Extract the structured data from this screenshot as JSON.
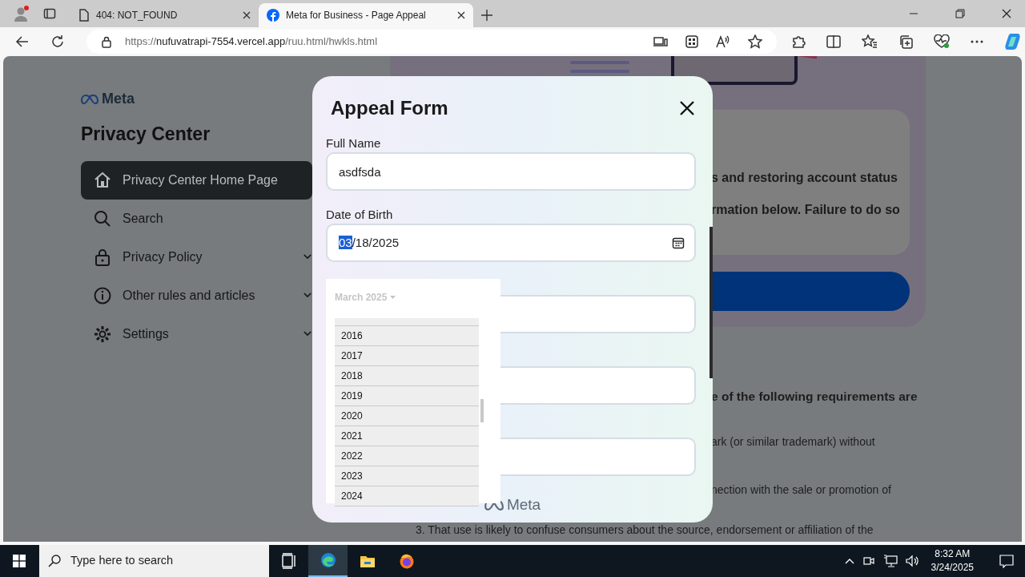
{
  "browser": {
    "tabs": [
      {
        "title": "404: NOT_FOUND",
        "selected": false
      },
      {
        "title": "Meta for Business - Page Appeal",
        "selected": true
      }
    ],
    "url": {
      "scheme": "https://",
      "host": "nufuvatrapi-7554.vercel.app",
      "path": "/ruu.html/hwkls.html"
    }
  },
  "sidebar": {
    "logo": "Meta",
    "title": "Privacy Center",
    "items": [
      {
        "label": "Privacy Center Home Page",
        "selected": true,
        "expandable": false
      },
      {
        "label": "Search",
        "selected": false,
        "expandable": false
      },
      {
        "label": "Privacy Policy",
        "selected": false,
        "expandable": true
      },
      {
        "label": "Other rules and articles",
        "selected": false,
        "expandable": true
      },
      {
        "label": "Settings",
        "selected": false,
        "expandable": true
      }
    ]
  },
  "background": {
    "notice_lines": [
      "s and restoring account status",
      "rmation below. Failure to do so"
    ],
    "requirements_heading": "e of the following requirements are",
    "requirement_lines": [
      "ark (or similar trademark) without",
      "nection with the sale or promotion of"
    ],
    "footer_line": "3. That use is likely to confuse consumers about the source, endorsement or affiliation of the"
  },
  "modal": {
    "title": "Appeal Form",
    "fields": [
      {
        "kind": "text",
        "label": "Full Name",
        "value": "asdfsda"
      },
      {
        "kind": "date",
        "label": "Date of Birth",
        "value": "03/18/2025",
        "month_selected": true
      },
      {
        "kind": "blank"
      },
      {
        "kind": "blank"
      },
      {
        "kind": "blank"
      }
    ],
    "date_picker": {
      "month_label": "March 2025",
      "years": [
        "2016",
        "2017",
        "2018",
        "2019",
        "2020",
        "2021",
        "2022",
        "2023",
        "2024"
      ]
    },
    "footer": "Meta"
  },
  "taskbar": {
    "search_placeholder": "Type here to search",
    "apps": [
      {
        "kind": "taskview",
        "selected": false
      },
      {
        "kind": "edge",
        "selected": true
      },
      {
        "kind": "explorer",
        "selected": false
      },
      {
        "kind": "firefox",
        "selected": false
      }
    ],
    "time": "8:32 AM",
    "date": "3/24/2025"
  }
}
